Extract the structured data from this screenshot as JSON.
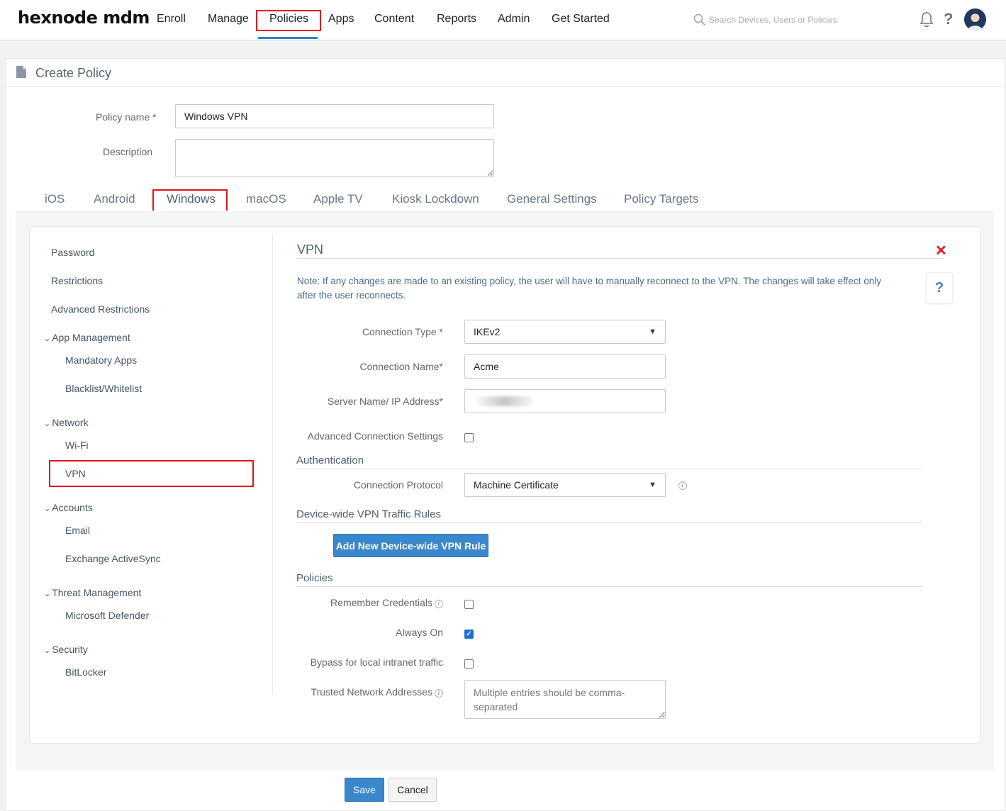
{
  "topbar": {
    "logo": "hexnode mdm",
    "nav": [
      "Enroll",
      "Manage",
      "Policies",
      "Apps",
      "Content",
      "Reports",
      "Admin",
      "Get Started"
    ],
    "active_nav": "Policies",
    "search_placeholder": "Search Devices, Users or Policies",
    "help_glyph": "?"
  },
  "page": {
    "title": "Create Policy",
    "policy_name_label": "Policy name *",
    "policy_name_value": "Windows VPN",
    "description_label": "Description",
    "description_value": ""
  },
  "os_tabs": [
    "iOS",
    "Android",
    "Windows",
    "macOS",
    "Apple TV",
    "Kiosk Lockdown",
    "General Settings",
    "Policy Targets"
  ],
  "active_os_tab": "Windows",
  "sidebar": {
    "items": [
      {
        "label": "Password"
      },
      {
        "label": "Restrictions"
      },
      {
        "label": "Advanced Restrictions"
      }
    ],
    "groups": [
      {
        "label": "App Management",
        "children": [
          "Mandatory Apps",
          "Blacklist/Whitelist"
        ]
      },
      {
        "label": "Network",
        "children": [
          "Wi-Fi",
          "VPN"
        ]
      },
      {
        "label": "Accounts",
        "children": [
          "Email",
          "Exchange ActiveSync"
        ]
      },
      {
        "label": "Threat Management",
        "children": [
          "Microsoft Defender"
        ]
      },
      {
        "label": "Security",
        "children": [
          "BitLocker"
        ]
      }
    ],
    "selected": "VPN"
  },
  "vpn": {
    "title": "VPN",
    "close_glyph": "✕",
    "help_glyph": "?",
    "note": "Note: If any changes are made to an existing policy, the user will have to manually reconnect to the VPN. The changes will take effect only after the user reconnects.",
    "connection_type_label": "Connection Type *",
    "connection_type_value": "IKEv2",
    "connection_name_label": "Connection Name*",
    "connection_name_value": "Acme",
    "server_label": "Server Name/ IP Address*",
    "advanced_label": "Advanced Connection Settings",
    "advanced_checked": false,
    "authentication_heading": "Authentication",
    "connection_protocol_label": "Connection Protocol",
    "connection_protocol_value": "Machine Certificate",
    "traffic_heading": "Device-wide VPN Traffic Rules",
    "add_rule_button": "Add New Device-wide VPN Rule",
    "policies_heading": "Policies",
    "remember_label": "Remember Credentials",
    "remember_checked": false,
    "always_on_label": "Always On",
    "always_on_checked": true,
    "bypass_label": "Bypass for local intranet traffic",
    "bypass_checked": false,
    "trusted_label": "Trusted Network Addresses",
    "trusted_placeholder": "Multiple entries should be comma-separated"
  },
  "footer": {
    "save": "Save",
    "cancel": "Cancel"
  },
  "colors": {
    "accent": "#3b87cc",
    "highlight_box": "#e3141b",
    "nav_underline": "#2f80d1"
  }
}
